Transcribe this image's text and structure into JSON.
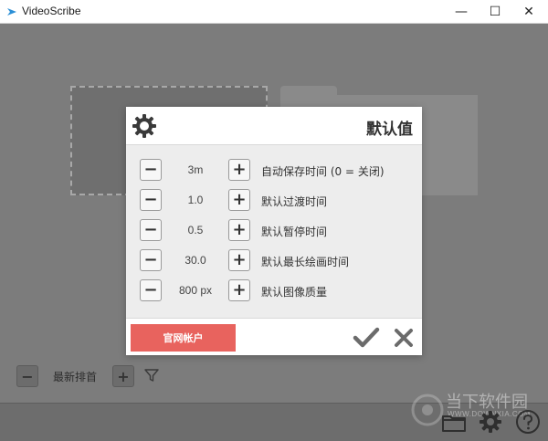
{
  "window": {
    "title": "VideoScribe",
    "minimize_glyph": "—",
    "maximize_glyph": "☐",
    "close_glyph": "✕",
    "icon": "videoscribe-logo-icon"
  },
  "background": {
    "sort_label": "最新排首",
    "minus_glyph": "−",
    "plus_glyph": "+",
    "icons": [
      "filter-icon",
      "folder-icon",
      "gear-icon",
      "help-icon"
    ]
  },
  "watermark": {
    "text": "当下软件园",
    "sub": "WWW.DOWNXIA.COM"
  },
  "modal": {
    "title": "默认值",
    "settings": [
      {
        "value": "3m",
        "label": "自动保存时间 (0 = 关闭)"
      },
      {
        "value": "1.0",
        "label": "默认过渡时间"
      },
      {
        "value": "0.5",
        "label": "默认暂停时间"
      },
      {
        "value": "30.0",
        "label": "默认最长绘画时间"
      },
      {
        "value": "800 px",
        "label": "默认图像质量"
      }
    ],
    "minus_glyph": "−",
    "plus_glyph": "+",
    "account_button": "官网帐户",
    "ok_icon": "checkmark-icon",
    "cancel_icon": "close-icon"
  },
  "colors": {
    "account_button": "#e8635e",
    "overlay": "#7b7b7b",
    "icon_gray": "#666666"
  }
}
